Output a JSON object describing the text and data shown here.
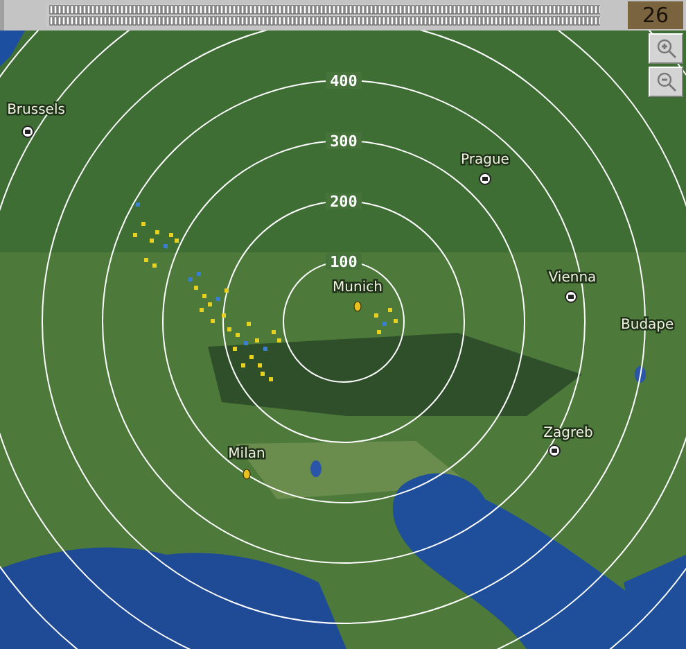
{
  "toolbar": {
    "counter": "26"
  },
  "map": {
    "range_rings": [
      {
        "label": "400"
      },
      {
        "label": "300"
      },
      {
        "label": "200"
      },
      {
        "label": "100"
      }
    ],
    "places": [
      {
        "name": "Brussels",
        "kind": "capital"
      },
      {
        "name": "Prague",
        "kind": "capital"
      },
      {
        "name": "Munich",
        "kind": "city"
      },
      {
        "name": "Vienna",
        "kind": "capital"
      },
      {
        "name": "Budape",
        "kind": "label"
      },
      {
        "name": "Zagreb",
        "kind": "capital"
      },
      {
        "name": "Milan",
        "kind": "city"
      }
    ]
  }
}
